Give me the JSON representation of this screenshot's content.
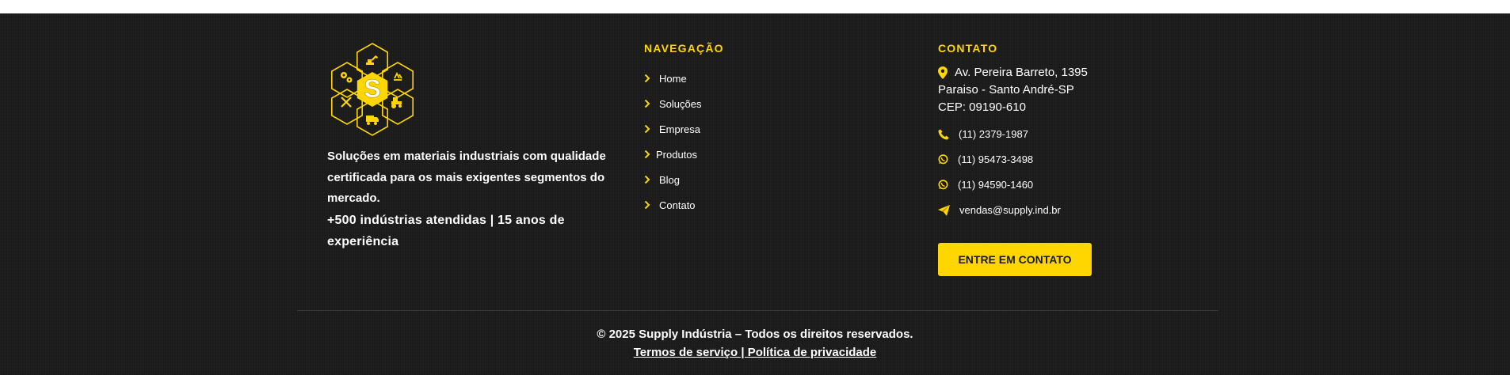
{
  "colors": {
    "accent": "#ffd600",
    "background": "#1c1c1c",
    "text": "#ffffff"
  },
  "brand": {
    "logo_letter": "S",
    "logo_icons": [
      "excavator-icon",
      "recycle-icon",
      "tractor-icon",
      "truck-icon",
      "tools-icon",
      "gears-icon"
    ]
  },
  "about": {
    "description": "Soluções em materiais industriais com qualidade certificada para os mais exigentes segmentos do mercado.",
    "stats": "+500 indústrias atendidas | 15 anos de experiência"
  },
  "navigation": {
    "title": "NAVEGAÇÃO",
    "items": [
      {
        "label": "Home",
        "icon": "chevron-right-icon"
      },
      {
        "label": "Soluções",
        "icon": "chevron-right-icon"
      },
      {
        "label": "Empresa",
        "icon": "chevron-right-icon"
      },
      {
        "label": "Produtos",
        "icon": "chevron-right-icon"
      },
      {
        "label": "Blog",
        "icon": "chevron-right-icon"
      },
      {
        "label": "Contato",
        "icon": "chevron-right-icon"
      }
    ]
  },
  "contact": {
    "title": "CONTATO",
    "address_line1": "Av. Pereira Barreto, 1395",
    "address_line2": "Paraiso - Santo André-SP",
    "address_line3": "CEP: 09190-610",
    "phone": "(11) 2379-1987",
    "whatsapp1": "(11) 95473-3498",
    "whatsapp2": "(11) 94590-1460",
    "email": "vendas@supply.ind.br",
    "cta_label": "ENTRE EM CONTATO"
  },
  "bottom": {
    "copyright": "© 2025 Supply Indústria – Todos os direitos reservados.",
    "legal_link": "Termos de serviço | Política de privacidade"
  }
}
